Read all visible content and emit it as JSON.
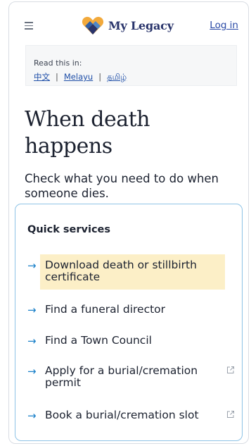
{
  "header": {
    "logo_text": "My Legacy",
    "login_label": "Log in"
  },
  "language": {
    "label": "Read this in:",
    "options": [
      "中文",
      "Melayu",
      "தமிழ்"
    ]
  },
  "hero": {
    "title_line1": "When death",
    "title_line2": "happens",
    "subtitle": "Check what you need to do when someone dies."
  },
  "quick_services": {
    "title": "Quick services",
    "items": [
      {
        "label_line1": "Download death or stillbirth",
        "label_line2": "certificate",
        "highlighted": true
      },
      {
        "label": "Find a funeral director"
      },
      {
        "label": "Find a Town Council"
      },
      {
        "label_line1": "Apply for a burial/cremation",
        "label_line2": "permit",
        "external": true
      },
      {
        "label": "Book a burial/cremation slot",
        "external": true
      }
    ]
  },
  "colors": {
    "accent": "#1a80c9",
    "brand": "#29346b",
    "highlight": "#fcefc7",
    "link": "#2a4aa6"
  },
  "icons": [
    "menu-icon",
    "heart-logo-icon",
    "arrow-right-icon",
    "external-link-icon"
  ]
}
